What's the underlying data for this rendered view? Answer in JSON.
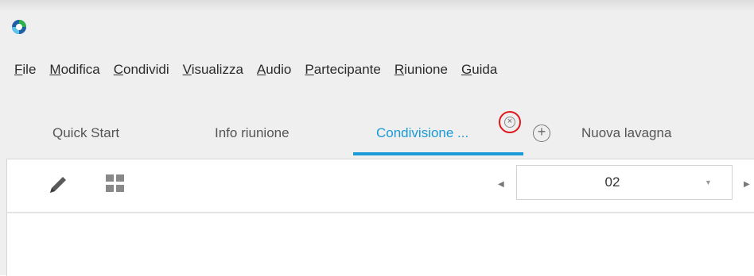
{
  "app": {
    "logo_icon": "webex-logo-icon"
  },
  "menu": [
    {
      "accel": "F",
      "rest": "ile"
    },
    {
      "accel": "M",
      "rest": "odifica"
    },
    {
      "accel": "C",
      "rest": "ondividi"
    },
    {
      "accel": "V",
      "rest": "isualizza"
    },
    {
      "accel": "A",
      "rest": "udio"
    },
    {
      "accel": "P",
      "rest": "artecipante"
    },
    {
      "accel": "R",
      "rest": "iunione"
    },
    {
      "accel": "G",
      "rest": "uida"
    }
  ],
  "tabs": {
    "quick_start": "Quick Start",
    "info": "Info riunione",
    "sharing": "Condivisione ...",
    "close_symbol": "×",
    "add_symbol": "+",
    "new_whiteboard": "Nuova lavagna"
  },
  "toolbar": {
    "pen_icon": "pen-icon",
    "grid_icon": "thumbnails-grid-icon",
    "prev_symbol": "◀",
    "next_symbol": "▶",
    "page_value": "02",
    "dropdown_symbol": "▼"
  },
  "colors": {
    "accent": "#1a9ad6",
    "highlight_circle": "#e0161b"
  }
}
